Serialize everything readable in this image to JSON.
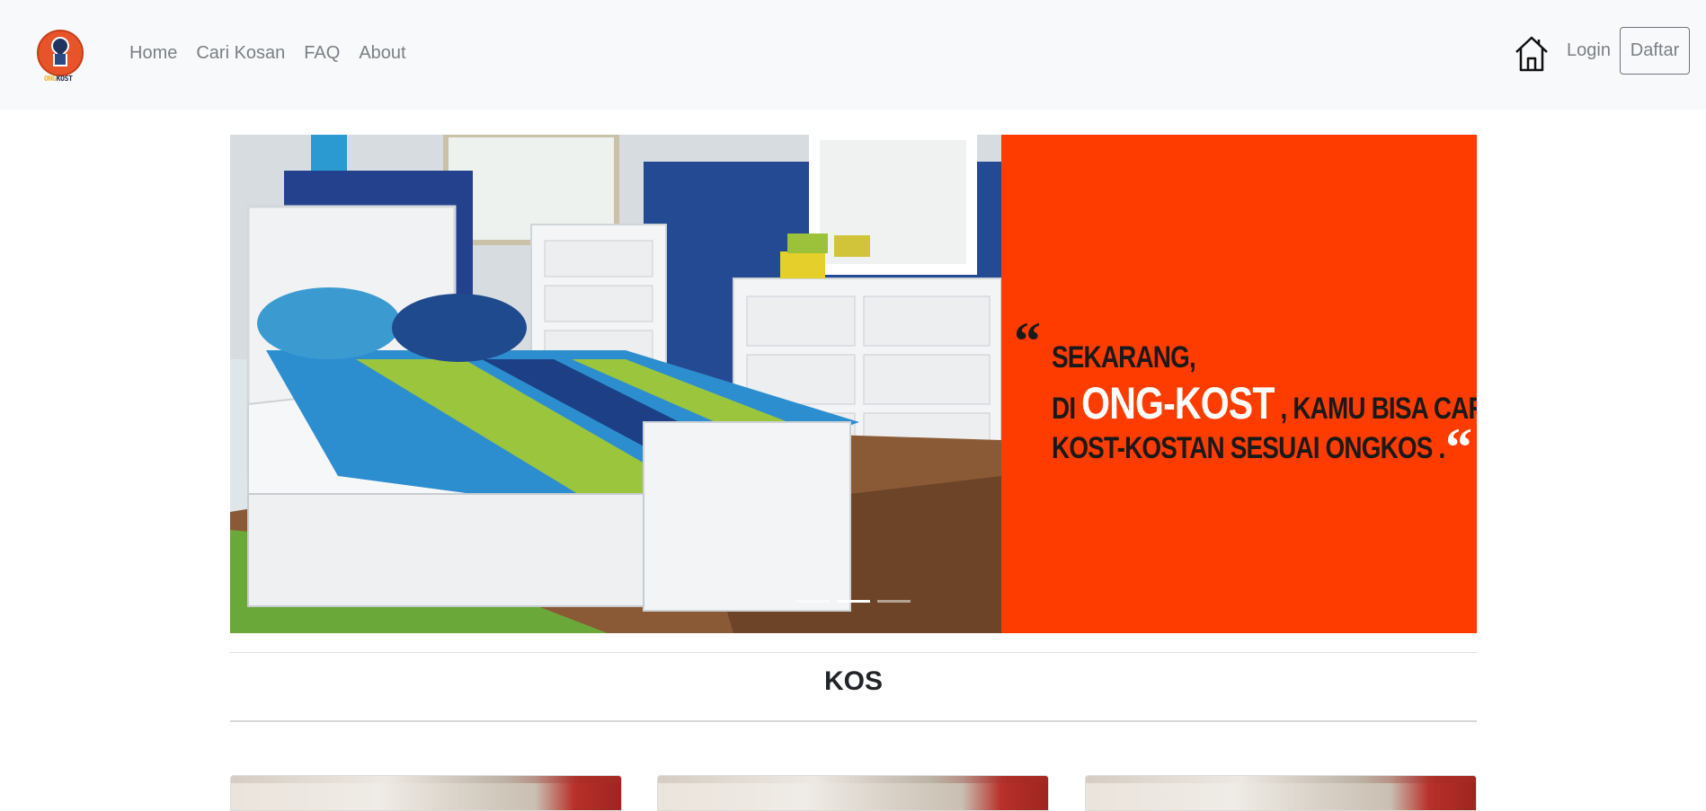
{
  "navbar": {
    "logo": {
      "icon": "ong-kost-logo",
      "text_ong": "ONG",
      "text_kost": "KOST"
    },
    "links": [
      "Home",
      "Cari Kosan",
      "FAQ",
      "About"
    ],
    "home_icon": "home-icon",
    "login_label": "Login",
    "daftar_label": "Daftar"
  },
  "carousel": {
    "quote_open": "“",
    "quote_line1": "SEKARANG,",
    "quote_line2_pre": "DI ",
    "quote_brand": "ONG-KOST",
    "quote_line2_post": " , KAMU BISA CARI",
    "quote_line3": "KOST-KOSTAN SESUAI ONGKOS .",
    "quote_close": "“",
    "slide_count": 3,
    "active_slide": 2,
    "colors": {
      "accent_panel": "#ff3c00",
      "brand_text": "#ffffff"
    }
  },
  "section": {
    "title": "KOS"
  },
  "cards": [
    "kos-card-1",
    "kos-card-2",
    "kos-card-3"
  ]
}
